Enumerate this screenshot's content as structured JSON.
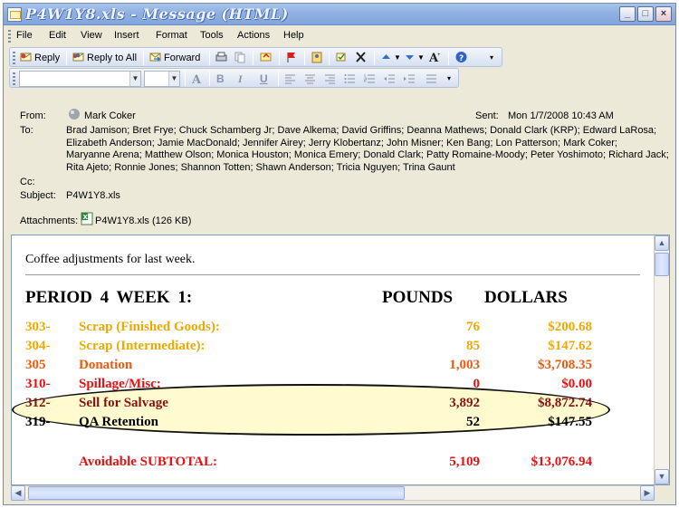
{
  "window": {
    "title": "P4W1Y8.xls - Message (HTML)",
    "buttons": {
      "minimize": "_",
      "maximize": "□",
      "close": "×"
    }
  },
  "menu": [
    "File",
    "Edit",
    "View",
    "Insert",
    "Format",
    "Tools",
    "Actions",
    "Help"
  ],
  "toolbar": {
    "reply": "Reply",
    "reply_all": "Reply to All",
    "forward": "Forward"
  },
  "format_toolbar": {
    "bold": "B",
    "italic": "I",
    "underline": "U"
  },
  "header": {
    "from_label": "From:",
    "from": "Mark Coker",
    "sent_label": "Sent:",
    "sent": "Mon 1/7/2008 10:43 AM",
    "to_label": "To:",
    "to_lines": [
      "Brad Jamison; Bret Frye; Chuck Schamberg Jr; Dave Alkema; David Griffins; Deanna Mathews; Donald Clark (KRP); Edward LaRosa;",
      "Elizabeth Anderson; Jamie MacDonald; Jennifer Airey; Jerry Klobertanz; John Misner; Ken Bang; Lon Patterson; Mark Coker;",
      "Maryanne Arena; Matthew Olson; Monica Houston; Monica Emery; Donald Clark; Patty Romaine-Moody; Peter Yoshimoto; Richard Jack;",
      "Rita Ajeto; Ronnie Jones; Shannon Totten; Shawn Anderson; Tricia Nguyen; Trina Gaunt"
    ],
    "cc_label": "Cc:",
    "subject_label": "Subject:",
    "subject": "P4W1Y8.xls",
    "attachments_label": "Attachments:",
    "attachment": "P4W1Y8.xls (126 KB)"
  },
  "body": {
    "intro": "Coffee adjustments for last week.",
    "heading_left": "PERIOD 4   WEEK 1:",
    "heading_pounds": "POUNDS",
    "heading_dollars": "DOLLARS",
    "rows": [
      {
        "code": "303-",
        "desc": "Scrap (Finished Goods):",
        "pounds": "76",
        "dollars": "$200.68",
        "color": "#f0a800"
      },
      {
        "code": "304-",
        "desc": "Scrap (Intermediate):",
        "pounds": "85",
        "dollars": "$147.62",
        "color": "#f0a800"
      },
      {
        "code": "305",
        "desc": "Donation",
        "pounds": "1,003",
        "dollars": "$3,708.35",
        "color": "#f05a10"
      },
      {
        "code": "310-",
        "desc": "Spillage/Misc:",
        "pounds": "0",
        "dollars": "$0.00",
        "color": "#e81010"
      },
      {
        "code": "312-",
        "desc": "Sell for Salvage",
        "pounds": "3,892",
        "dollars": "$8,872.74",
        "color": "#8a1010"
      },
      {
        "code": "319-",
        "desc": "QA Retention",
        "pounds": "52",
        "dollars": "$147.55",
        "color": "#000000"
      }
    ],
    "subtotal": {
      "label": "Avoidable SUBTOTAL:",
      "pounds": "5,109",
      "dollars": "$13,076.94",
      "color": "#e81010"
    }
  }
}
